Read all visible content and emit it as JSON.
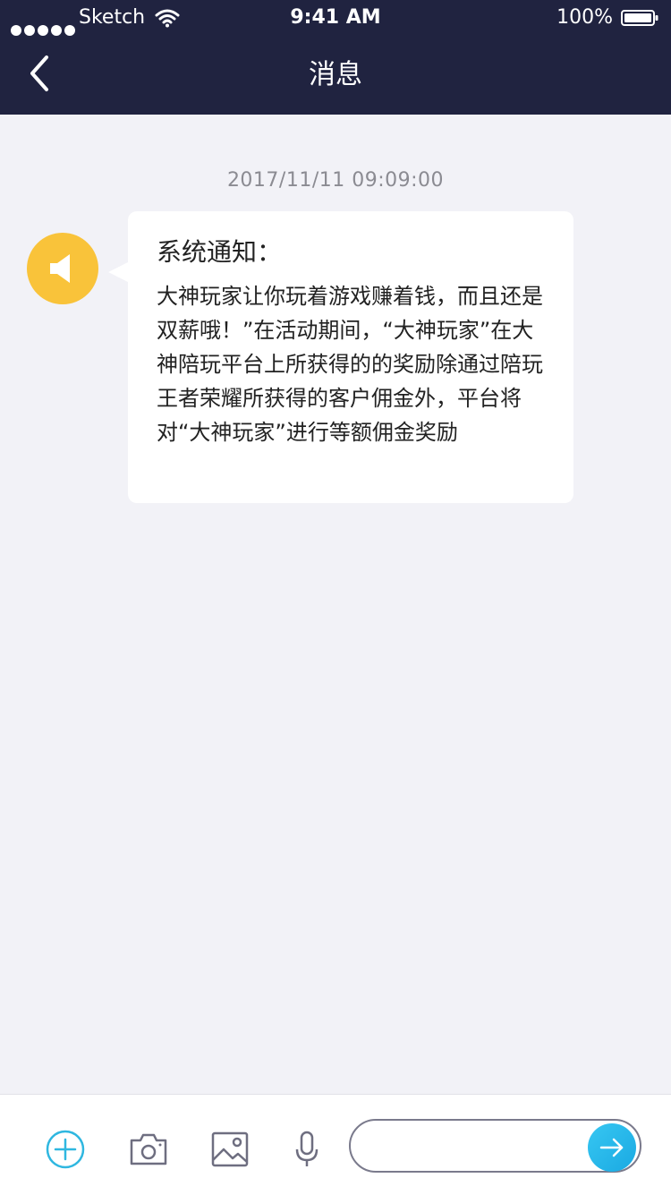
{
  "status_bar": {
    "carrier": "Sketch",
    "time": "9:41 AM",
    "battery": "100%"
  },
  "nav": {
    "title": "消息",
    "back_icon": "chevron-left-icon"
  },
  "messages": [
    {
      "timestamp": "2017/11/11    09:09:00",
      "avatar_icon": "speaker-icon",
      "title": "系统通知：",
      "body": "大神玩家让你玩着游戏赚着钱，而且还是双薪哦！”在活动期间，“大神玩家”在大神陪玩平台上所获得的的奖励除通过陪玩王者荣耀所获得的客户佣金外，平台将对“大神玩家”进行等额佣金奖励"
    }
  ],
  "input_bar": {
    "icons": [
      "plus-circle-icon",
      "camera-icon",
      "image-icon",
      "microphone-icon"
    ],
    "input_value": "",
    "input_placeholder": "",
    "send_icon": "arrow-right-icon"
  },
  "colors": {
    "nav_background": "#202340",
    "page_background": "#f2f2f7",
    "avatar": "#f9c33a",
    "accent": "#25b9e8"
  }
}
